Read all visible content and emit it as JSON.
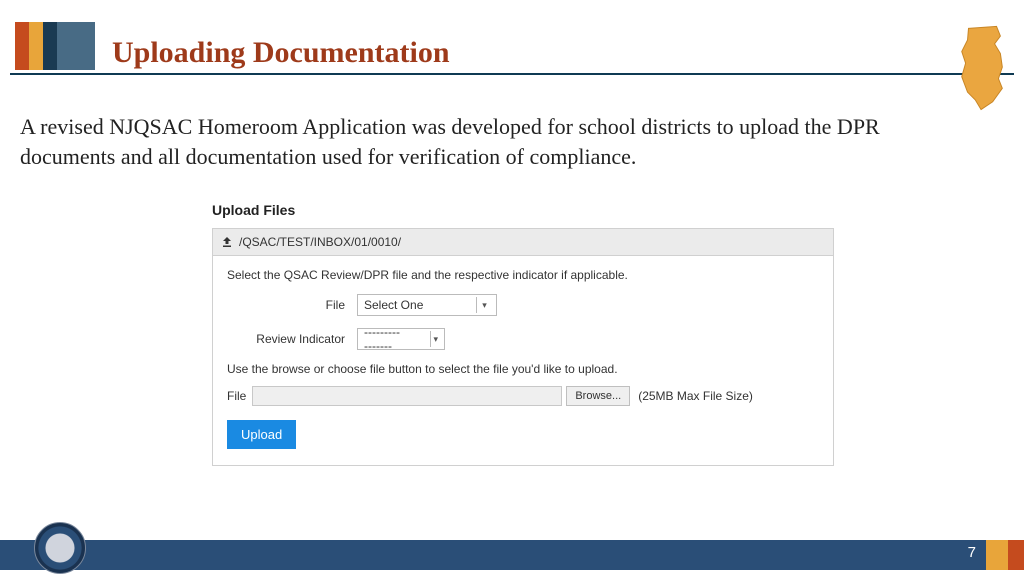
{
  "header": {
    "title": "Uploading Documentation"
  },
  "body": {
    "paragraph": "A revised NJQSAC Homeroom Application was developed for school districts to upload the DPR  documents and all documentation used for  verification of compliance."
  },
  "upload": {
    "heading": "Upload Files",
    "path": "/QSAC/TEST/INBOX/01/0010/",
    "instruction1": "Select the QSAC Review/DPR file and the respective indicator if applicable.",
    "fileLabel": "File",
    "fileSelect": "Select One",
    "reviewLabel": "Review Indicator",
    "reviewSelect": "----------------",
    "instruction2": "Use the browse or choose file button to select the file you'd like to upload.",
    "fileRowLabel": "File",
    "browseLabel": "Browse...",
    "maxNote": "(25MB Max File Size)",
    "uploadButton": "Upload"
  },
  "footer": {
    "pageNumber": "7"
  }
}
